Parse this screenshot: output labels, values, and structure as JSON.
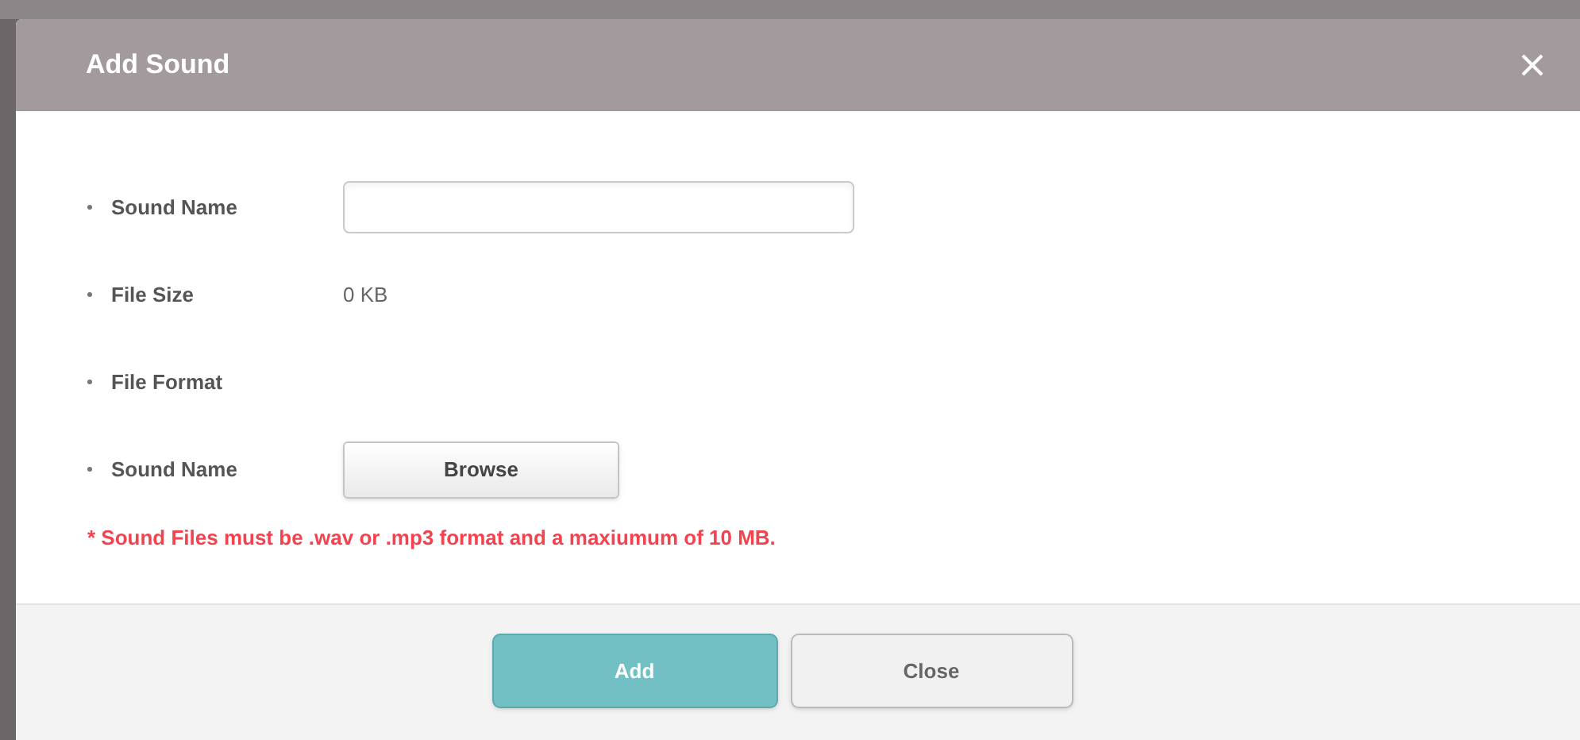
{
  "dialog": {
    "title": "Add Sound",
    "fields": [
      {
        "kind": "input",
        "label": "Sound Name"
      },
      {
        "kind": "text",
        "label": "File Size",
        "value": "0 KB"
      },
      {
        "kind": "text",
        "label": "File Format"
      },
      {
        "kind": "button",
        "label": "Sound Name",
        "button": "Browse"
      }
    ],
    "note": "* Sound Files must be .wav or .mp3 format and a maxiumum of 10 MB.",
    "buttons": [
      {
        "label": "Add",
        "kind": "primary"
      },
      {
        "label": "Close",
        "kind": "secondary"
      }
    ]
  }
}
